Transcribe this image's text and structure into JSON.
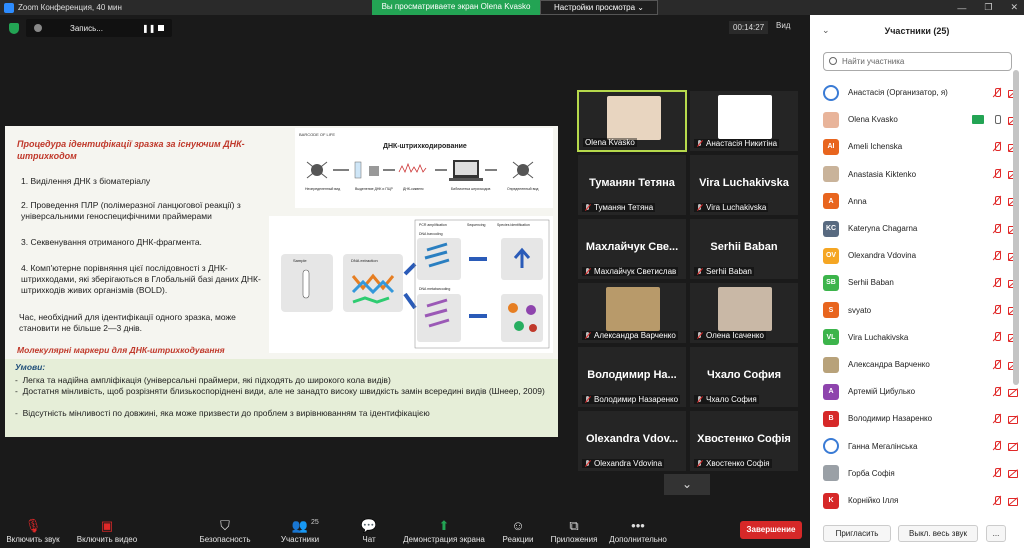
{
  "window": {
    "title": "Zoom Конференция, 40 мин",
    "share_banner": "Вы просматриваете экран Olena Kvasko",
    "view_options": "Настройки просмотра ⌄",
    "btn_min": "—",
    "btn_max": "❐",
    "btn_close": "✕"
  },
  "topbar": {
    "recording_label": "Запись...",
    "pause": "❚❚",
    "timer": "00:14:27",
    "view_label": "Вид"
  },
  "slide": {
    "title": "Процедура ідентифікації зразка за існуючим ДНК-штрихкодом",
    "steps": [
      "1. Виділення ДНК з біоматеріалу",
      "2. Проведення ПЛР (полімеразної ланцюгової реакції) з універсальними геноспецифічними праймерами",
      "3. Секвенування отриманого ДНК-фрагмента.",
      "4. Комп'ютерне порівняння цієї послідовності з ДНК-штрихкодами, які зберігаються в Глобальній базі даних ДНК-штрихкодів живих організмів (BOLD)."
    ],
    "time_note": "Час, необхідний для ідентифікації одного зразка, може становити не більше 2—3 днів.",
    "markers_title": "Молекулярні маркери для ДНК-штрихкодування",
    "conditions_label": "Умови:",
    "conditions": [
      "Легка та надійна ампліфікація (універсальні праймери, які підходять до широкого кола видів)",
      "Достатня мінливість, щоб розрізняти близькоспоріднені види, але не занадто високу швидкість замін всередині видів (Шнеер, 2009)",
      "Відсутність мінливості по довжині, яка може призвести до проблем з вирівнюванням та ідентифікацією"
    ],
    "fig1": {
      "logo": "BARCODE OF LIFE",
      "title": "ДНК-штрихкодирование",
      "labels": [
        "Неопределенный вид",
        "Выделение ДНК и ПЦР",
        "ДНК-сиквенс",
        "Библиотека штрихкодов",
        "Определенный вид"
      ]
    },
    "fig2": {
      "headers": [
        "PCR amplification",
        "Sequencing",
        "Species identification"
      ],
      "row1": "DNA barcoding",
      "row2": "DNA metabarcoding",
      "sample": "Sample",
      "extraction": "DNA extraction"
    }
  },
  "gallery": [
    {
      "name": "Olena Kvasko",
      "big": "",
      "photo": true,
      "active": true
    },
    {
      "name": "Анастасія Никитіна",
      "big": "",
      "photo": true
    },
    {
      "name": "Туманян Тетяна",
      "big": "Туманян Тетяна"
    },
    {
      "name": "Vira Luchakivska",
      "big": "Vira Luchakivska"
    },
    {
      "name": "Махлайчук Светислав",
      "big": "Махлайчук Све..."
    },
    {
      "name": "Serhii Baban",
      "big": "Serhii Baban"
    },
    {
      "name": "Александра Варченко",
      "big": "",
      "photo": true
    },
    {
      "name": "Олена Ісаченко",
      "big": "",
      "photo": true
    },
    {
      "name": "Володимир Назаренко",
      "big": "Володимир На..."
    },
    {
      "name": "Чхало София",
      "big": "Чхало София"
    },
    {
      "name": "Olexandra Vdovina",
      "big": "Olexandra Vdov..."
    },
    {
      "name": "Хвостенко Софія",
      "big": "Хвостенко Софія"
    }
  ],
  "scroll_down": "⌄",
  "toolbar": {
    "mute": "Включить звук",
    "video": "Включить видео",
    "security": "Безопасность",
    "participants": "Участники",
    "participants_count": "25",
    "chat": "Чат",
    "share": "Демонстрация экрана",
    "reactions": "Реакции",
    "apps": "Приложения",
    "more": "Дополнительно",
    "end": "Завершение"
  },
  "panel": {
    "title": "Участники (25)",
    "search_placeholder": "Найти участника",
    "participants": [
      {
        "name": "Анастасія  (Организатор, я)",
        "initials": "",
        "color": "#3a7bd5",
        "logo": true
      },
      {
        "name": "Olena Kvasko",
        "initials": "",
        "color": "#e8b49a",
        "share": true
      },
      {
        "name": "Ameli  Ichenska",
        "initials": "AI",
        "color": "#e8651e"
      },
      {
        "name": "Anastasia Kiktenko",
        "initials": "",
        "color": "#c9b39a"
      },
      {
        "name": "Anna",
        "initials": "A",
        "color": "#e8651e"
      },
      {
        "name": "Kateryna Chagarna",
        "initials": "KC",
        "color": "#586a80"
      },
      {
        "name": "Olexandra Vdovina",
        "initials": "OV",
        "color": "#f5a623"
      },
      {
        "name": "Serhii Baban",
        "initials": "SB",
        "color": "#3cb44b"
      },
      {
        "name": "svyato",
        "initials": "S",
        "color": "#e8651e"
      },
      {
        "name": "Vira Luchakivska",
        "initials": "VL",
        "color": "#3cb44b"
      },
      {
        "name": "Александра Варченко",
        "initials": "",
        "color": "#b8a27a"
      },
      {
        "name": "Артемій Цибулько",
        "initials": "A",
        "color": "#8e44ad"
      },
      {
        "name": "Володимир Назаренко",
        "initials": "B",
        "color": "#d62828"
      },
      {
        "name": "Ганна Мегалінська",
        "initials": "",
        "color": "#3a7bd5",
        "logo": true
      },
      {
        "name": "Горба Софія",
        "initials": "",
        "color": "#9aa0a6"
      },
      {
        "name": "Корнійко Ілля",
        "initials": "K",
        "color": "#d62828"
      }
    ],
    "invite": "Пригласить",
    "mute_all": "Выкл. весь звук",
    "more": "..."
  }
}
